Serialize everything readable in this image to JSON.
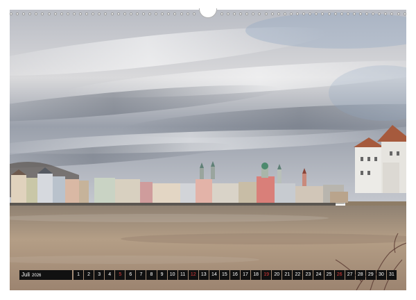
{
  "calendar": {
    "month": "Juli",
    "year": "2026",
    "days": [
      "1",
      "2",
      "3",
      "4",
      "5",
      "6",
      "7",
      "8",
      "9",
      "10",
      "11",
      "12",
      "13",
      "14",
      "15",
      "16",
      "17",
      "18",
      "19",
      "20",
      "21",
      "22",
      "23",
      "24",
      "25",
      "26",
      "27",
      "28",
      "29",
      "30",
      "31"
    ],
    "sundays": [
      "5",
      "12",
      "19",
      "26"
    ],
    "sunday_color": "#e23b3b",
    "bar_color": "#111111"
  },
  "photo": {
    "subject": "river-town-panorama",
    "sky_color": "#c9ccd3",
    "water_color": "#a58f78"
  }
}
